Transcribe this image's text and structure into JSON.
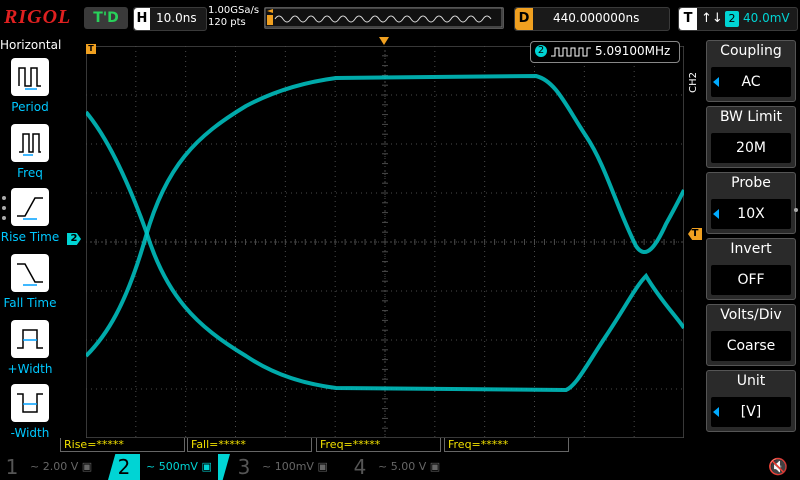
{
  "header": {
    "logo": "RIGOL",
    "run_status": "T'D",
    "timebase_key": "H",
    "timebase_value": "10.0ns",
    "sample_rate": "1.00GSa/s",
    "points": "120 pts",
    "delay_key": "D",
    "delay_value": "440.000000ns",
    "trigger_key": "T",
    "trigger_arrows": "↑↓",
    "trigger_channel": "2",
    "trigger_level": "40.0mV"
  },
  "left_menu": {
    "title": "Horizontal",
    "items": [
      {
        "label": "Period",
        "icon": "period-icon"
      },
      {
        "label": "Freq",
        "icon": "freq-icon"
      },
      {
        "label": "Rise Time",
        "icon": "rise-time-icon"
      },
      {
        "label": "Fall Time",
        "icon": "fall-time-icon"
      },
      {
        "label": "+Width",
        "icon": "positive-width-icon"
      },
      {
        "label": "-Width",
        "icon": "negative-width-icon"
      }
    ]
  },
  "plot": {
    "trigger_marker_label": "T",
    "channel_marker_label": "2",
    "trigger_level_marker_label": "T",
    "frequency_counter": {
      "channel": "2",
      "value": "5.09100MHz"
    },
    "colors": {
      "grid": "#4a4a4a",
      "trace": "#00c8c8",
      "trigger": "#f0a020"
    }
  },
  "measurements": [
    {
      "label": "Rise=*****"
    },
    {
      "label": "Fall=*****"
    },
    {
      "label": "Freq=*****"
    },
    {
      "label": "Freq=*****"
    }
  ],
  "channels": [
    {
      "num": "1",
      "scale": "2.00 V",
      "color": "#555555"
    },
    {
      "num": "2",
      "scale": "500mV",
      "color": "#00d4d4"
    },
    {
      "num": "3",
      "scale": "100mV",
      "color": "#555555"
    },
    {
      "num": "4",
      "scale": "5.00 V",
      "color": "#555555"
    }
  ],
  "right_menu": {
    "channel_tag": "CH2",
    "items": [
      {
        "title": "Coupling",
        "value": "AC"
      },
      {
        "title": "BW Limit",
        "value": "20M"
      },
      {
        "title": "Probe",
        "value": "10X"
      },
      {
        "title": "Invert",
        "value": "OFF"
      },
      {
        "title": "Volts/Div",
        "value": "Coarse"
      },
      {
        "title": "Unit",
        "value": "[V]"
      }
    ]
  }
}
